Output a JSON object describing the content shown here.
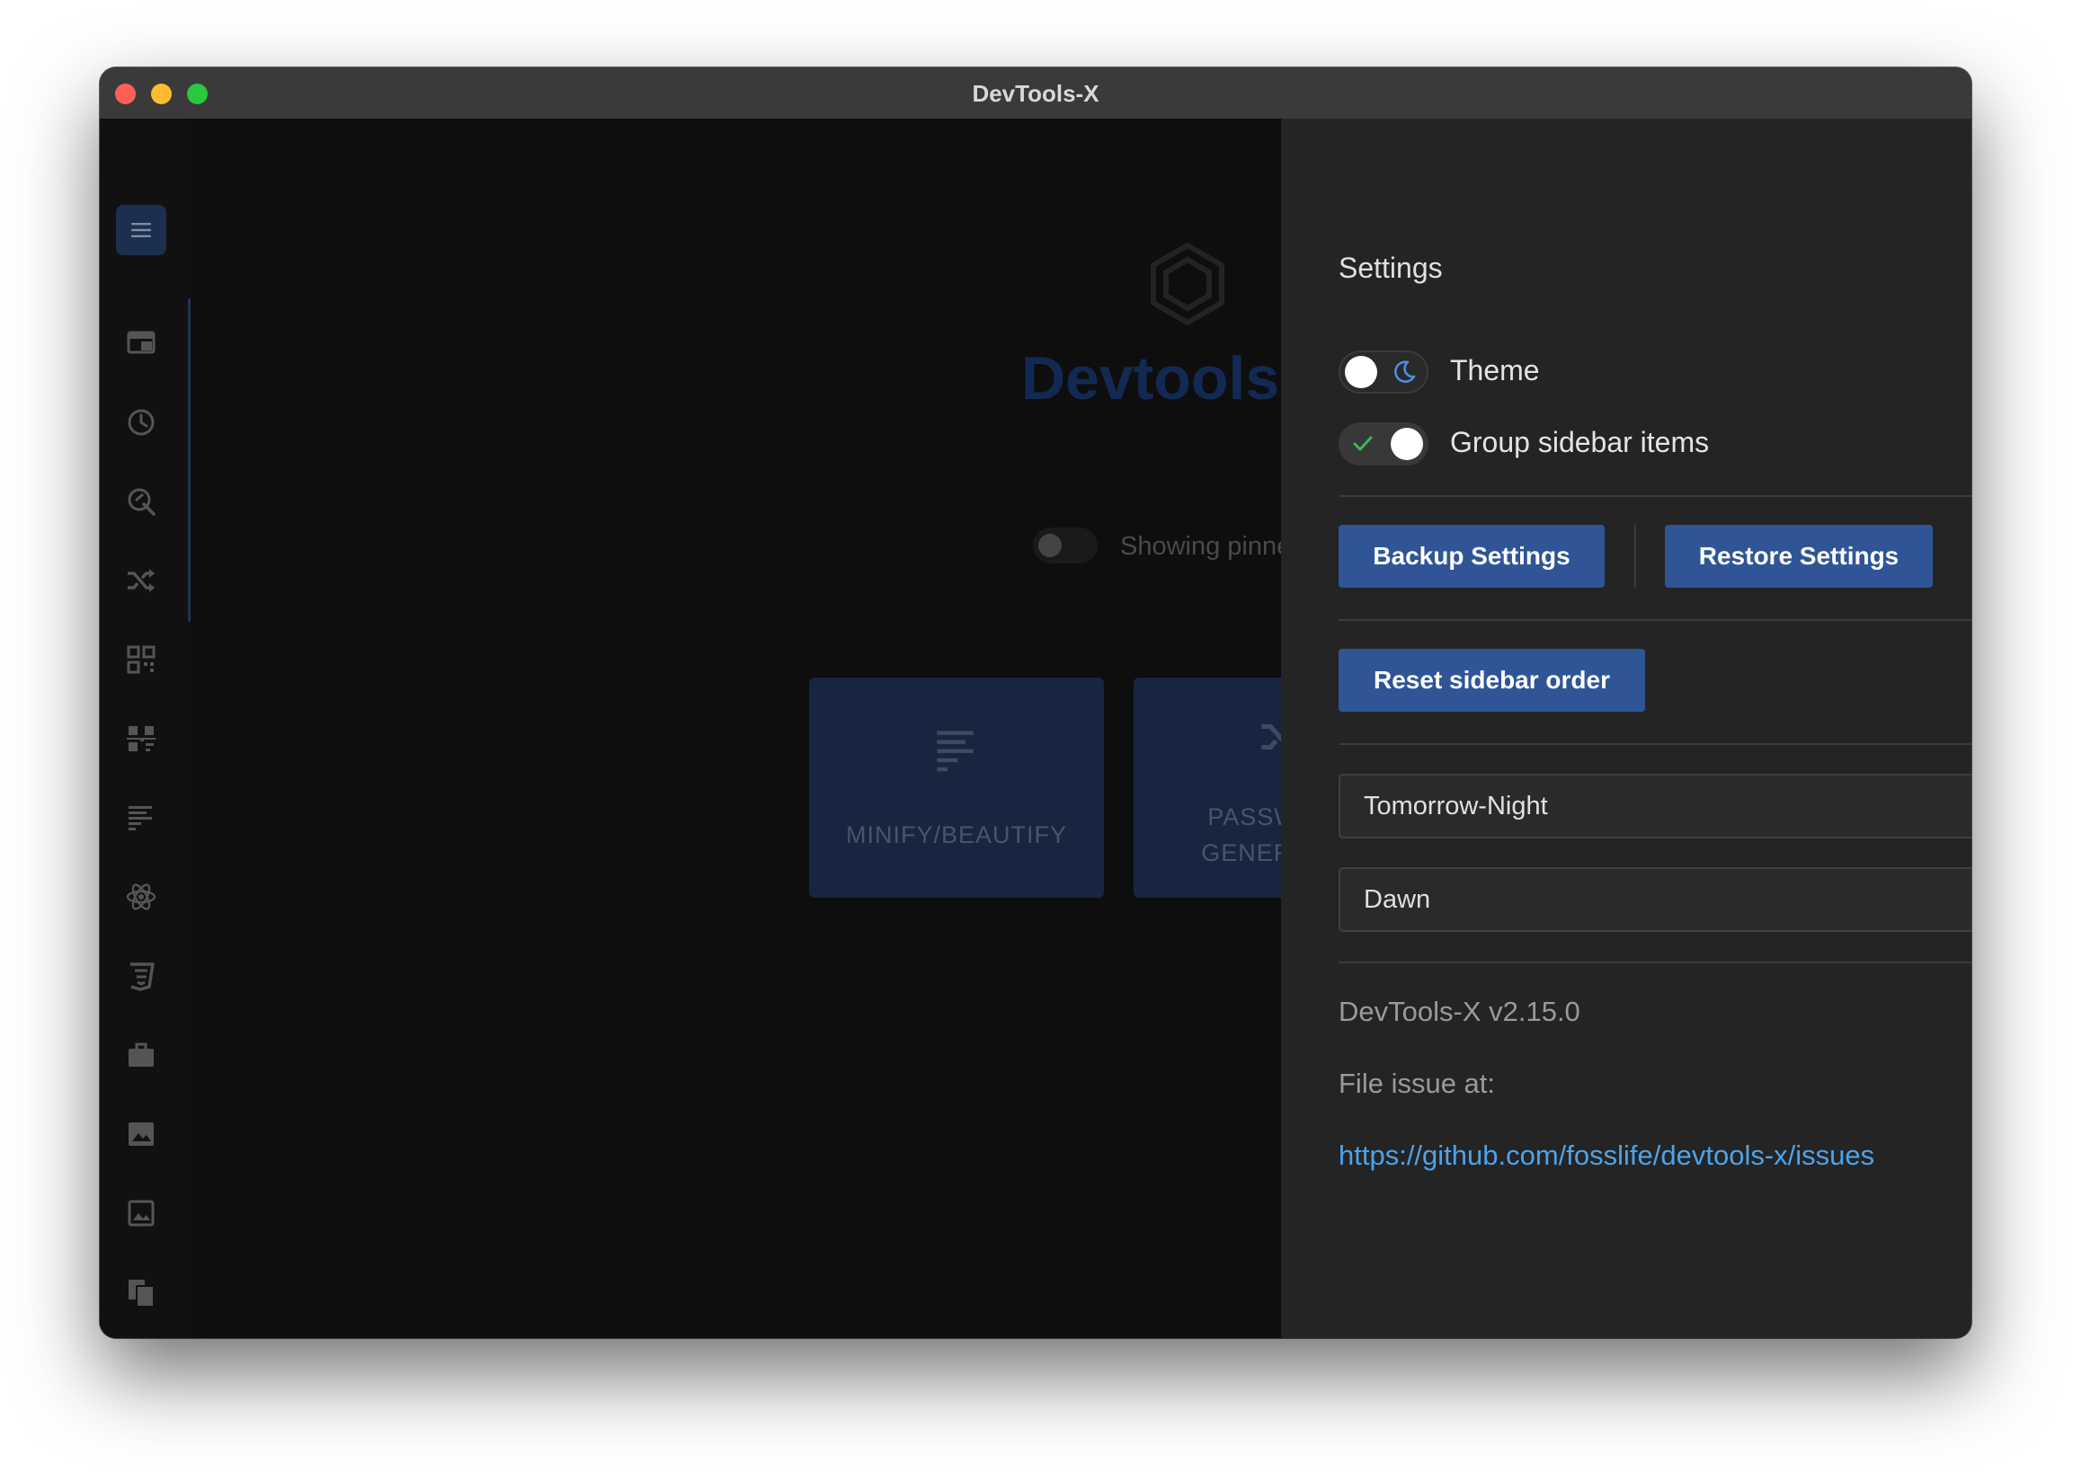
{
  "window": {
    "title": "DevTools-X"
  },
  "sidebar": {
    "items": [
      {
        "icon": "menu-icon"
      },
      {
        "icon": "browser-window-icon"
      },
      {
        "icon": "clock-icon"
      },
      {
        "icon": "search-check-icon"
      },
      {
        "icon": "shuffle-icon"
      },
      {
        "icon": "qr-code-icon"
      },
      {
        "icon": "barcode-scan-icon"
      },
      {
        "icon": "text-align-icon"
      },
      {
        "icon": "react-atom-icon"
      },
      {
        "icon": "css3-icon"
      },
      {
        "icon": "briefcase-icon"
      },
      {
        "icon": "image-icon"
      },
      {
        "icon": "image-frame-icon"
      },
      {
        "icon": "copy-files-icon"
      },
      {
        "icon": "code-tag-icon"
      }
    ]
  },
  "main": {
    "brand": "Devtools",
    "pinned_label": "Showing pinned",
    "cards": [
      {
        "label": "MINIFY/BEAUTIFY",
        "icon": "text-align-icon"
      },
      {
        "label_line1": "PASSWORD",
        "label_line2": "GENERATOR",
        "icon": "shuffle-icon"
      }
    ]
  },
  "settings": {
    "title": "Settings",
    "theme_label": "Theme",
    "group_label": "Group sidebar items",
    "backup_label": "Backup Settings",
    "restore_label": "Restore Settings",
    "reset_label": "Reset sidebar order",
    "editor_theme": "Tomorrow-Night",
    "light_theme": "Dawn",
    "version": "DevTools-X v2.15.0",
    "issue_label": "File issue at:",
    "issue_url": "https://github.com/fosslife/devtools-x/issues"
  },
  "colors": {
    "accent": "#2f5596",
    "link": "#4da3ea",
    "panel": "#242424"
  }
}
